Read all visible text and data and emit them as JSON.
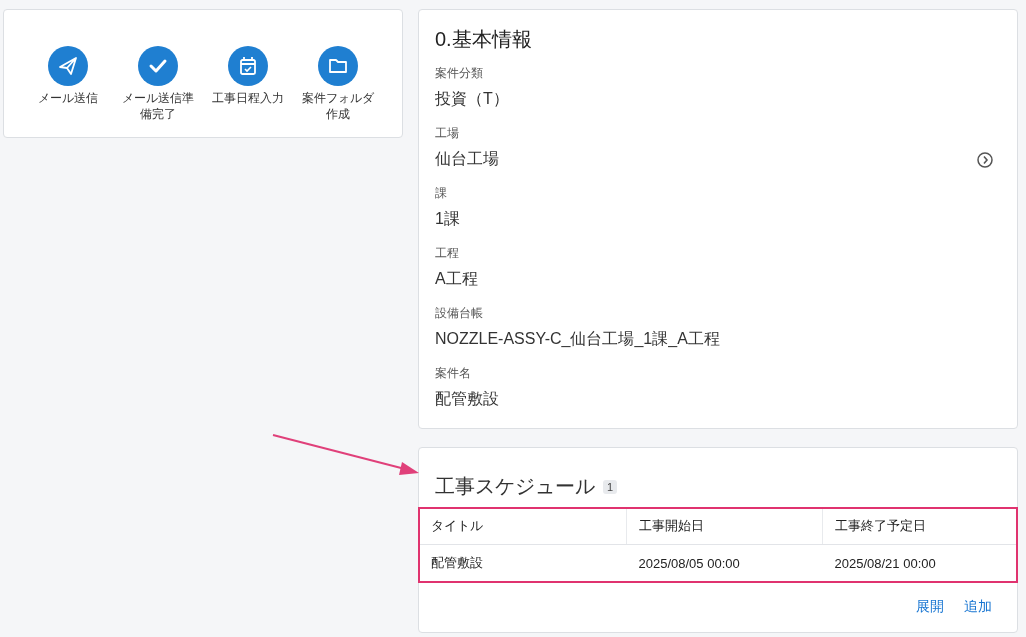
{
  "actions": [
    {
      "kind": "send",
      "label": "メール送信"
    },
    {
      "kind": "check",
      "label": "メール送信準備完了"
    },
    {
      "kind": "calendar",
      "label": "工事日程入力"
    },
    {
      "kind": "folder",
      "label": "案件フォルダ作成"
    }
  ],
  "basic_info": {
    "title": "0.基本情報",
    "fields": [
      {
        "label": "案件分類",
        "value": "投資（T）",
        "link": false
      },
      {
        "label": "工場",
        "value": "仙台工場",
        "link": true
      },
      {
        "label": "課",
        "value": "1課",
        "link": false
      },
      {
        "label": "工程",
        "value": "A工程",
        "link": false
      },
      {
        "label": "設備台帳",
        "value": "NOZZLE-ASSY-C_仙台工場_1課_A工程",
        "link": false
      },
      {
        "label": "案件名",
        "value": "配管敷設",
        "link": false
      }
    ]
  },
  "schedule": {
    "title": "工事スケジュール",
    "count": "1",
    "highlighted": true,
    "callout_arrow": true,
    "columns": [
      "タイトル",
      "工事開始日",
      "工事終了予定日"
    ],
    "rows": [
      [
        "配管敷設",
        "2025/08/05 00:00",
        "2025/08/21 00:00"
      ]
    ],
    "links": [
      "展開",
      "追加"
    ]
  }
}
